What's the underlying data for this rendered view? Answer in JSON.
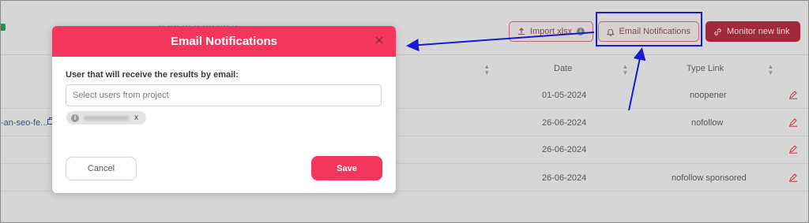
{
  "toolbar": {
    "import_label": "Import xlsx",
    "email_notifications_label": "Email Notifications",
    "monitor_label": "Monitor new link"
  },
  "table": {
    "columns": {
      "date": "Date",
      "type_link": "Type Link"
    },
    "rows": [
      {
        "url": "",
        "date": "01-05-2024",
        "type_link": "noopener"
      },
      {
        "url": "-an-seo-fe...",
        "date": "26-06-2024",
        "type_link": "nofollow"
      },
      {
        "url": "",
        "date": "26-06-2024",
        "type_link": ""
      },
      {
        "url": "",
        "date": "26-06-2024",
        "type_link": "nofollow sponsored"
      }
    ]
  },
  "modal": {
    "title": "Email Notifications",
    "field_label": "User that will receive the results by email:",
    "select_placeholder": "Select users from project",
    "chip_remove": "x",
    "cancel_label": "Cancel",
    "save_label": "Save"
  },
  "colors": {
    "accent": "#f5365c",
    "annotation": "#1a1ad4"
  }
}
